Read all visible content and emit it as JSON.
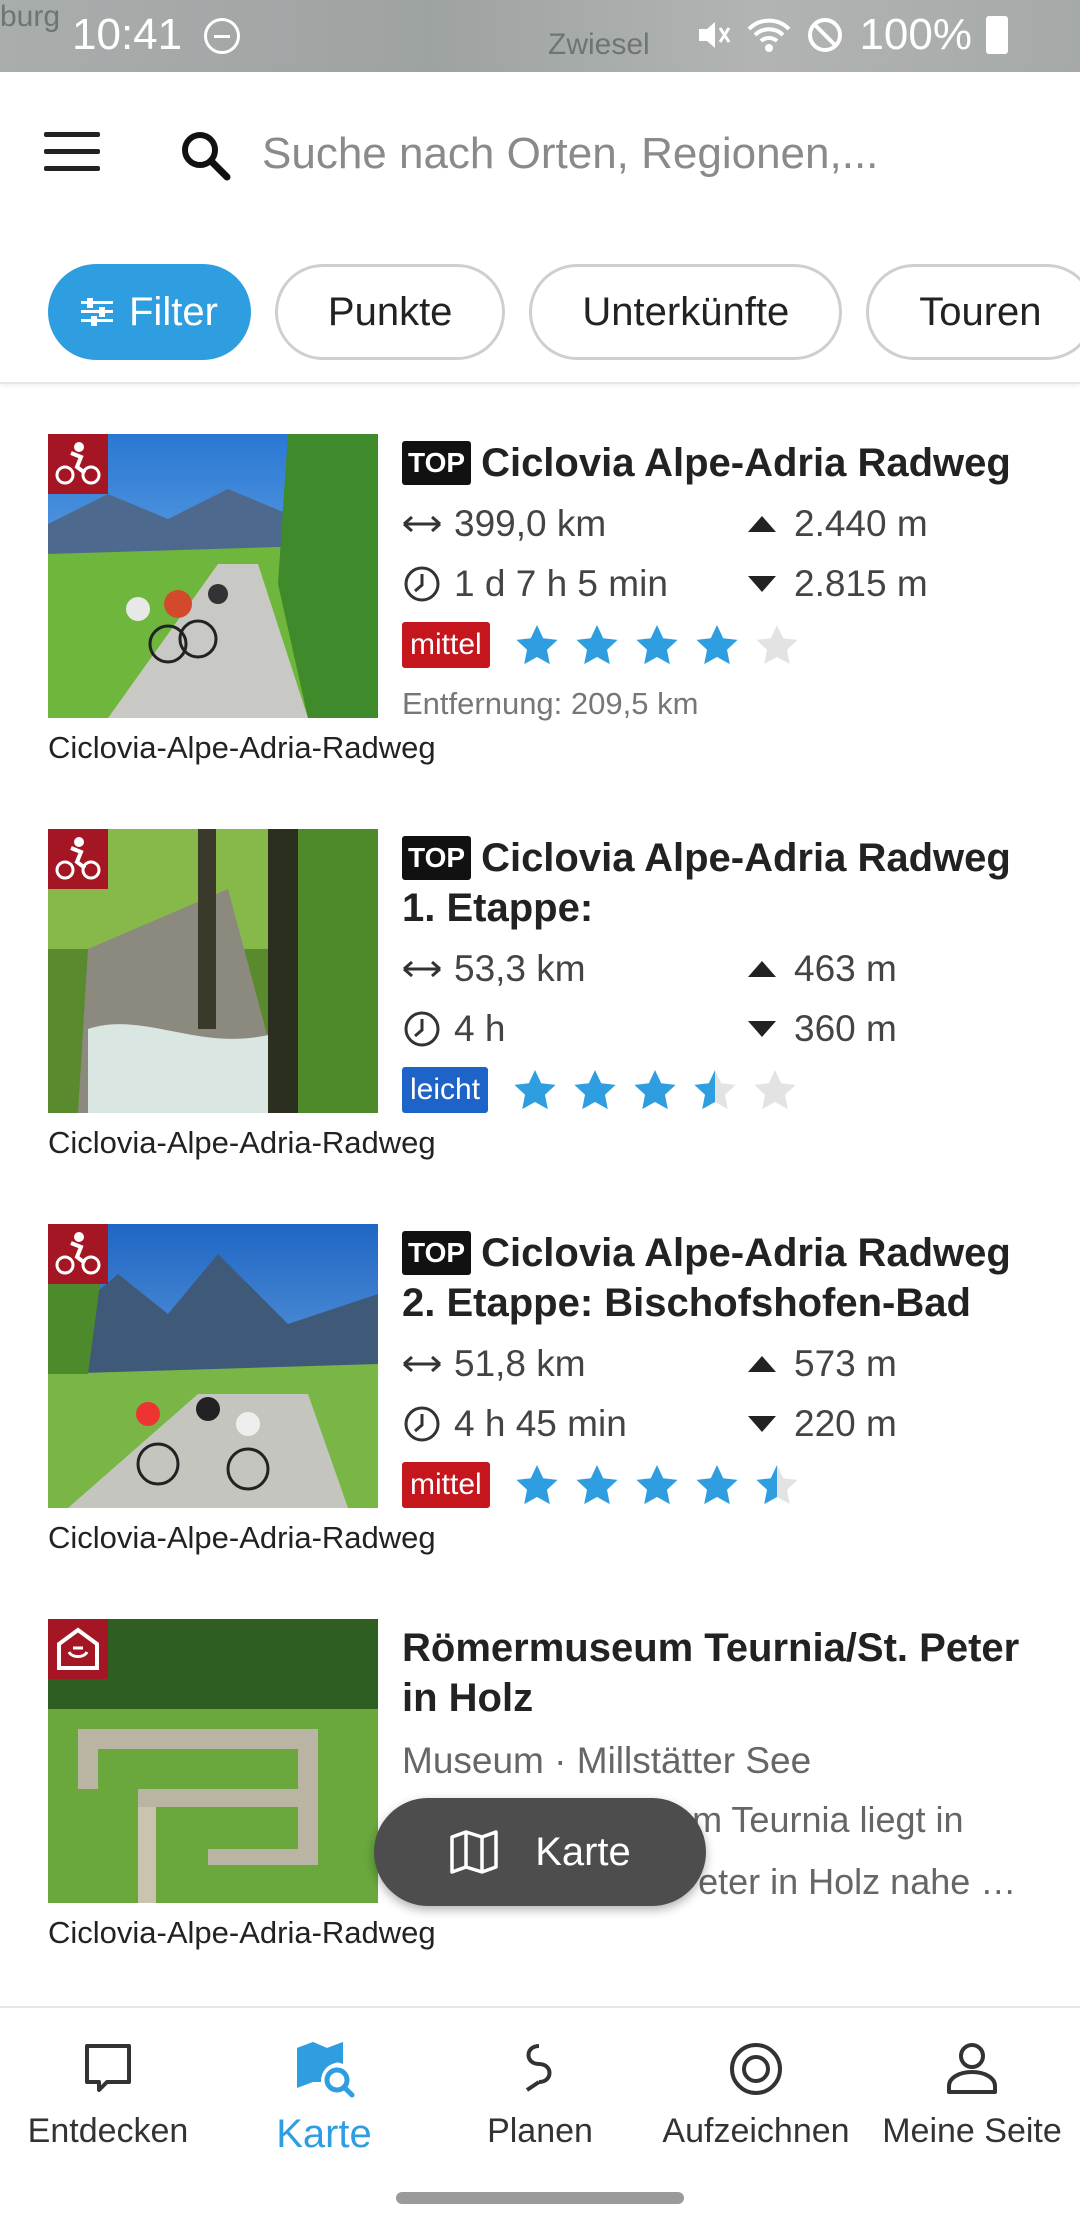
{
  "status_bar": {
    "time": "10:41",
    "battery": "100%",
    "map_words": [
      "burg",
      "Zwiesel"
    ]
  },
  "search": {
    "placeholder": "Suche nach Orten, Regionen,..."
  },
  "chips": [
    {
      "label": "Filter",
      "active": true
    },
    {
      "label": "Punkte",
      "active": false
    },
    {
      "label": "Unterkünfte",
      "active": false
    },
    {
      "label": "Touren",
      "active": false
    }
  ],
  "items": [
    {
      "top": "TOP",
      "title": "Ciclovia Alpe-Adria Radweg",
      "distance": "399,0 km",
      "duration": "1 d 7 h 5 min",
      "ascent": "2.440 m",
      "descent": "2.815 m",
      "difficulty": "mittel",
      "rating": 4,
      "distance_from": "Entfernung: 209,5 km",
      "caption": "Ciclovia-Alpe-Adria-Radweg",
      "category_icon": "cycling-icon"
    },
    {
      "top": "TOP",
      "title": "Ciclovia Alpe-Adria Radweg 1. Etappe:",
      "distance": "53,3 km",
      "duration": "4 h",
      "ascent": "463 m",
      "descent": "360 m",
      "difficulty": "leicht",
      "rating": 3.5,
      "caption": "Ciclovia-Alpe-Adria-Radweg",
      "category_icon": "cycling-icon"
    },
    {
      "top": "TOP",
      "title": "Ciclovia Alpe-Adria Radweg 2. Etappe: Bischofshofen-Bad",
      "distance": "51,8 km",
      "duration": "4 h 45 min",
      "ascent": "573 m",
      "descent": "220 m",
      "difficulty": "mittel",
      "rating": 4.5,
      "caption": "Ciclovia-Alpe-Adria-Radweg",
      "category_icon": "cycling-icon"
    },
    {
      "title": "Römermuseum Teurnia/St. Peter in Holz",
      "subtitle": "Museum · Millstätter See",
      "desc_line1": "Das Römermuseum Teurnia liegt in",
      "desc_line2": "der Ortschaft St. Peter in Holz nahe zum Hügel von...",
      "caption": "Ciclovia-Alpe-Adria-Radweg",
      "category_icon": "museum-icon"
    }
  ],
  "fab": {
    "label": "Karte"
  },
  "bottom_nav": [
    {
      "label": "Entdecken",
      "active": false
    },
    {
      "label": "Karte",
      "active": true
    },
    {
      "label": "Planen",
      "active": false
    },
    {
      "label": "Aufzeichnen",
      "active": false
    },
    {
      "label": "Meine Seite",
      "active": false
    }
  ],
  "colors": {
    "accent": "#2f9ee0",
    "mittel": "#c4161c",
    "leicht": "#1e64c8",
    "top": "#111111",
    "category_badge": "#a51624"
  }
}
